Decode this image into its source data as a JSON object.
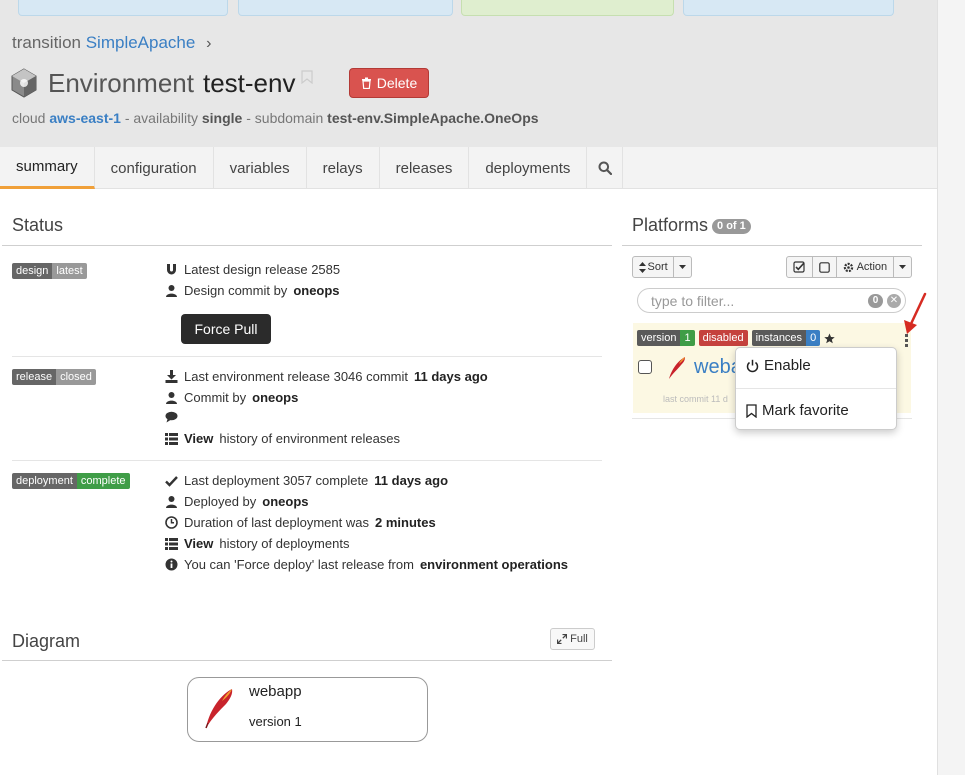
{
  "breadcrumb": {
    "prefix": "transition",
    "link": "SimpleApache"
  },
  "environment": {
    "label": "Environment",
    "name": "test-env",
    "delete_label": "Delete"
  },
  "subtitle": {
    "cloud_label": "cloud",
    "cloud": "aws-east-1",
    "availability_label": " - availability ",
    "availability": "single",
    "subdomain_label": " - subdomain ",
    "subdomain": "test-env.SimpleApache.OneOps"
  },
  "tabs": [
    "summary",
    "configuration",
    "variables",
    "relays",
    "releases",
    "deployments"
  ],
  "status": {
    "title": "Status",
    "design": {
      "label": "design",
      "state": "latest",
      "release_line": "Latest design release 2585",
      "commit_prefix": "Design commit by",
      "commit_user": "oneops",
      "force_pull_label": "Force Pull"
    },
    "release": {
      "label": "release",
      "state": "closed",
      "line_prefix": "Last environment release 3046 commit",
      "line_age": "11 days ago",
      "commit_prefix": "Commit by",
      "commit_user": "oneops",
      "view_link": "View",
      "view_suffix": "history of environment releases"
    },
    "deployment": {
      "label": "deployment",
      "state": "complete",
      "line_prefix": "Last deployment 3057 complete",
      "line_age": "11 days ago",
      "deployed_prefix": "Deployed by",
      "deployed_user": "oneops",
      "duration_prefix": "Duration of last deployment was",
      "duration": "2 minutes",
      "view_link": "View",
      "view_suffix": "history of deployments",
      "info_prefix": "You can 'Force deploy' last release from",
      "info_link": "environment operations"
    }
  },
  "diagram": {
    "title": "Diagram",
    "full_label": "Full",
    "node_name": "webapp",
    "node_version": "version 1"
  },
  "platforms": {
    "title": "Platforms",
    "count": "0 of 1",
    "sort_label": "Sort",
    "action_label": "Action",
    "filter_placeholder": "type to filter...",
    "filter_count": "0",
    "card": {
      "version_label": "version",
      "version_value": "1",
      "disabled_label": "disabled",
      "instances_label": "instances",
      "instances_value": "0",
      "name_visible": "weba",
      "footer_visible": "last commit 11 d"
    },
    "menu": {
      "enable": "Enable",
      "favorite": "Mark favorite"
    }
  },
  "colors": {
    "accent_tab": "#f0a039",
    "link": "#3a7fc4",
    "danger": "#d9534f",
    "success": "#3f9d47",
    "highlight": "#fcf8e3"
  }
}
